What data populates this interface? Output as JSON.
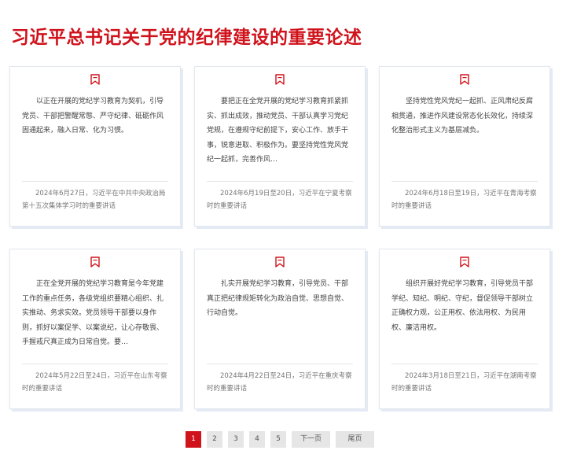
{
  "page": {
    "title": "习近平总书记关于党的纪律建设的重要论述"
  },
  "colors": {
    "accent": "#d0121b",
    "card_border": "#e3e7ef",
    "page_button": "#e6e6e6"
  },
  "cards": [
    {
      "icon": "bookmark-icon",
      "summary": "以正在开展的党纪学习教育为契机，引导党员、干部把警醒常態、严守纪律、砥砺作风固通起来，融入日常、化为习惯。",
      "source": "2024年6月27日，习近平在中共中央政治局第十五次集体学习时的重要讲话"
    },
    {
      "icon": "bookmark-icon",
      "summary": "要把正在全党开展的党纪学习教育抓紧抓实、抓出成效，推动党员、干部认真学习党纪党规，在遵规守纪前提下，安心工作、放手干事，锐意进取、积极作为。要坚持党性党风党纪一起抓，完善作风…",
      "source": "2024年6月19日至20日，习近平在宁夏考察时的重要讲话"
    },
    {
      "icon": "bookmark-icon",
      "summary": "坚持党性党风党纪一起抓、正风肃纪反腐相贯通，推进作风建设常态化长效化，持续深化整治形式主义为基层减负。",
      "source": "2024年6月18日至19日，习近平在青海考察时的重要讲话"
    },
    {
      "icon": "bookmark-icon",
      "summary": "正在全党开展的党纪学习教育是今年党建工作的重点任务，各级党组织要精心组织、扎实推动、务求实效。党员领导干部要以身作则，抓好以案促学、以案说纪，让心存敬畏、手握戒尺真正成为日常自觉。要…",
      "source": "2024年5月22日至24日，习近平在山东考察时的重要讲话"
    },
    {
      "icon": "bookmark-icon",
      "summary": "扎实开展党纪学习教育，引导党员、干部真正把纪律规矩转化为政治自觉、思想自觉、行动自觉。",
      "source": "2024年4月22日至24日，习近平在重庆考察时的重要讲话"
    },
    {
      "icon": "bookmark-icon",
      "summary": "组织开展好党纪学习教育，引导党员干部学纪、知纪、明纪、守纪，督促领导干部树立正确权力观，公正用权、依法用权、为民用权、廉洁用权。",
      "source": "2024年3月18日至21日，习近平在湖南考察时的重要讲话"
    }
  ],
  "pagination": {
    "pages": [
      "1",
      "2",
      "3",
      "4",
      "5"
    ],
    "current": "1",
    "next_label": "下一页",
    "last_label": "尾页"
  }
}
